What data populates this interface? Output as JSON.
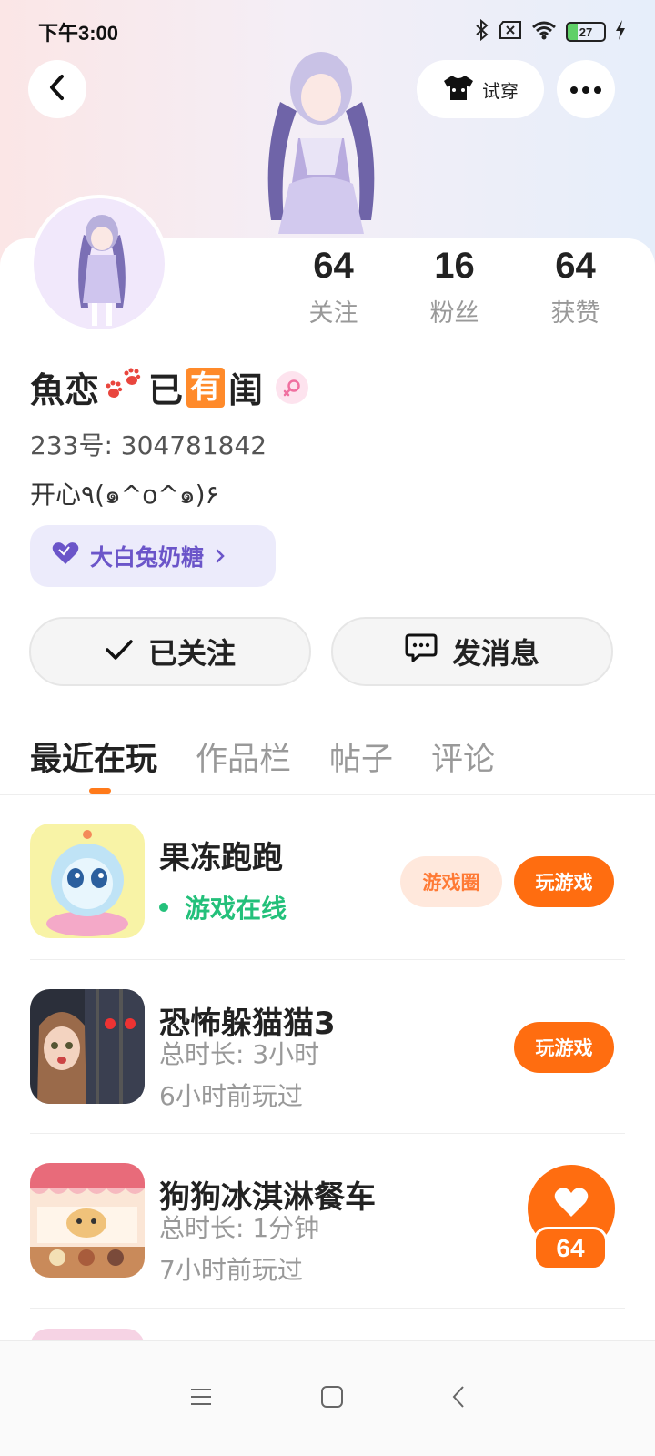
{
  "status_bar": {
    "time": "下午3:00",
    "battery": "27",
    "icons": [
      "bluetooth-icon",
      "sim-off-icon",
      "wifi-icon",
      "battery-icon",
      "charging-icon"
    ]
  },
  "header": {
    "back_icon": "chevron-left-icon",
    "tryon_label": "试穿",
    "more_icon": "more-dots-icon"
  },
  "profile": {
    "stats": [
      {
        "value": "64",
        "label": "关注"
      },
      {
        "value": "16",
        "label": "粉丝"
      },
      {
        "value": "64",
        "label": "获赞"
      }
    ],
    "username_parts": [
      "魚恋",
      "已",
      "有",
      "闺"
    ],
    "gender": "female",
    "uid": "233号: 304781842",
    "bio": "开心٩(๑^o^๑)۶",
    "vip_label": "大白兔奶糖",
    "follow_label": "已关注",
    "message_label": "发消息"
  },
  "tabs": [
    "最近在玩",
    "作品栏",
    "帖子",
    "评论"
  ],
  "active_tab": 0,
  "games": [
    {
      "title": "果冻跑跑",
      "status": "游戏在线",
      "circle_label": "游戏圈",
      "play_label": "玩游戏"
    },
    {
      "title": "恐怖躲猫猫3",
      "duration": "总时长: 3小时",
      "last_played": "6小时前玩过",
      "play_label": "玩游戏"
    },
    {
      "title": "狗狗冰淇淋餐车",
      "duration": "总时长: 1分钟",
      "last_played": "7小时前玩过"
    }
  ],
  "like_float": {
    "count": "64"
  },
  "colors": {
    "accent": "#ff6d10",
    "online": "#23c07a",
    "vip": "#6b55c9"
  },
  "nav_bar": {
    "icons": [
      "menu-icon",
      "home-square-icon",
      "back-triangle-icon"
    ]
  }
}
